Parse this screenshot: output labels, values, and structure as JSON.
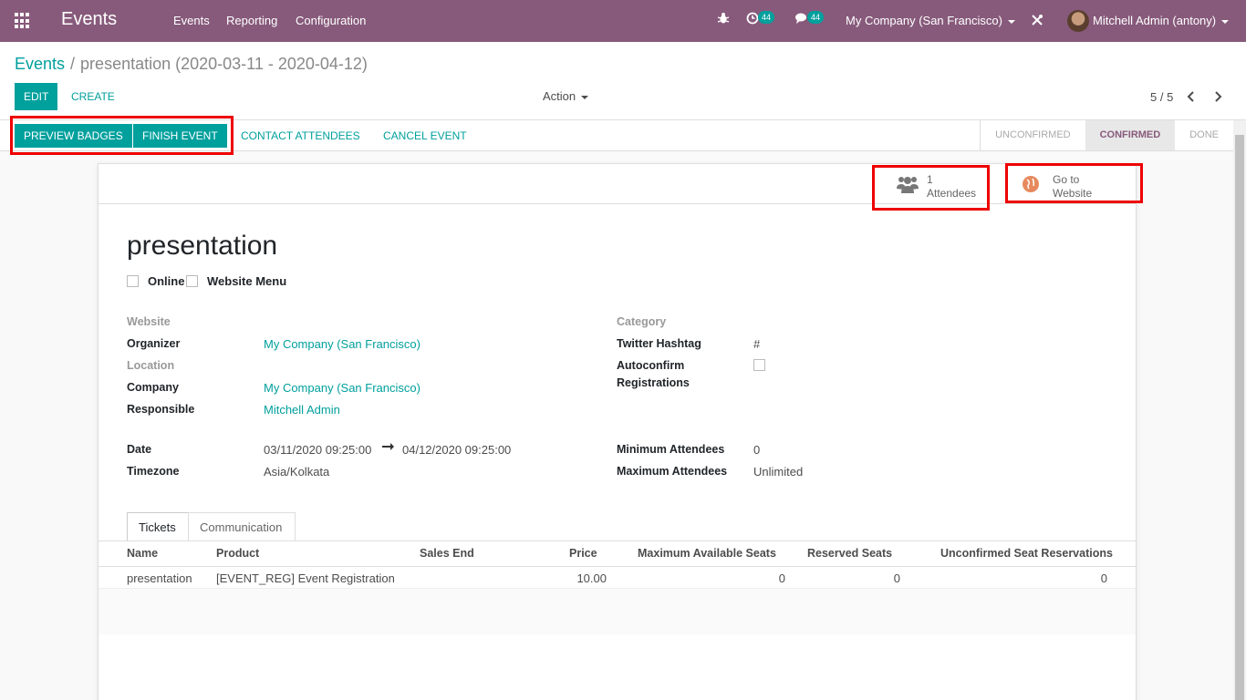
{
  "topbar": {
    "app_title": "Events",
    "menu": [
      "Events",
      "Reporting",
      "Configuration"
    ],
    "activity_count": "44",
    "message_count": "44",
    "company": "My Company (San Francisco)",
    "user": "Mitchell Admin (antony)"
  },
  "breadcrumb": {
    "parent": "Events",
    "separator": "/",
    "current": "presentation (2020-03-11 - 2020-04-12)"
  },
  "control": {
    "edit_label": "Edit",
    "create_label": "Create",
    "action_label": "Action",
    "pager": "5 / 5"
  },
  "statusbar": {
    "buttons": [
      "Preview Badges",
      "Finish Event",
      "Contact Attendees",
      "Cancel Event"
    ],
    "stages": [
      "Unconfirmed",
      "Confirmed",
      "Done"
    ],
    "active_stage": "Confirmed"
  },
  "smart_buttons": {
    "attendees_count": "1",
    "attendees_label": "Attendees",
    "website_line1": "Go to",
    "website_line2": "Website"
  },
  "event": {
    "name": "presentation",
    "online_label": "Online",
    "website_menu_label": "Website Menu"
  },
  "fields_left": {
    "website_label": "Website",
    "organizer_label": "Organizer",
    "organizer": "My Company (San Francisco)",
    "location_label": "Location",
    "company_label": "Company",
    "company": "My Company (San Francisco)",
    "responsible_label": "Responsible",
    "responsible": "Mitchell Admin",
    "date_label": "Date",
    "date_begin": "03/11/2020 09:25:00",
    "date_end": "04/12/2020 09:25:00",
    "timezone_label": "Timezone",
    "timezone": "Asia/Kolkata"
  },
  "fields_right": {
    "category_label": "Category",
    "twitter_label": "Twitter Hashtag",
    "twitter": "#",
    "autoconfirm_label_1": "Autoconfirm",
    "autoconfirm_label_2": "Registrations",
    "min_label": "Minimum Attendees",
    "min": "0",
    "max_label": "Maximum Attendees",
    "max": "Unlimited"
  },
  "tabs": [
    "Tickets",
    "Communication"
  ],
  "table": {
    "headers": [
      "Name",
      "Product",
      "Sales End",
      "Price",
      "Maximum Available Seats",
      "Reserved Seats",
      "Unconfirmed Seat Reservations"
    ],
    "rows": [
      [
        "presentation",
        "[EVENT_REG] Event Registration",
        "",
        "10.00",
        "0",
        "0",
        "0"
      ]
    ]
  },
  "colors": {
    "brand": "#875a7b",
    "accent": "#00a09d",
    "highlight": "#ee0000"
  }
}
